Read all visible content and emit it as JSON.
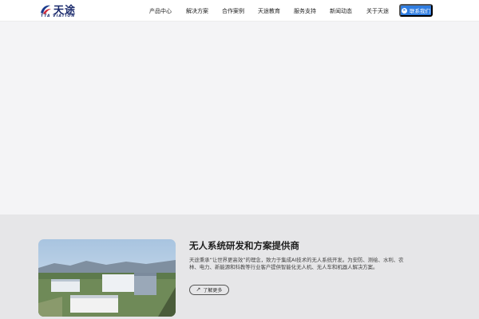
{
  "brand": {
    "name_cn": "天途",
    "name_en": "TTA VIATION",
    "accent_color": "#2f7de1"
  },
  "nav": {
    "items": [
      "产品中心",
      "解决方案",
      "合作案例",
      "天途教育",
      "服务支持",
      "新闻动态",
      "关于天途"
    ],
    "contact_label": "联系我们",
    "contact_icon": "compass-icon"
  },
  "about": {
    "title": "无人系统研发和方案提供商",
    "description": "天途秉承“让世界更高效”的理念，致力于集成AI技术的无人系统开发。为安防、测绘、水利、农林、电力、新能源和科教等行业客户提供智能化无人机、无人车和机器人解决方案。",
    "more_label": "了解更多",
    "more_icon": "arrow-up-right-icon",
    "photo_icon": "factory-aerial-photo"
  }
}
